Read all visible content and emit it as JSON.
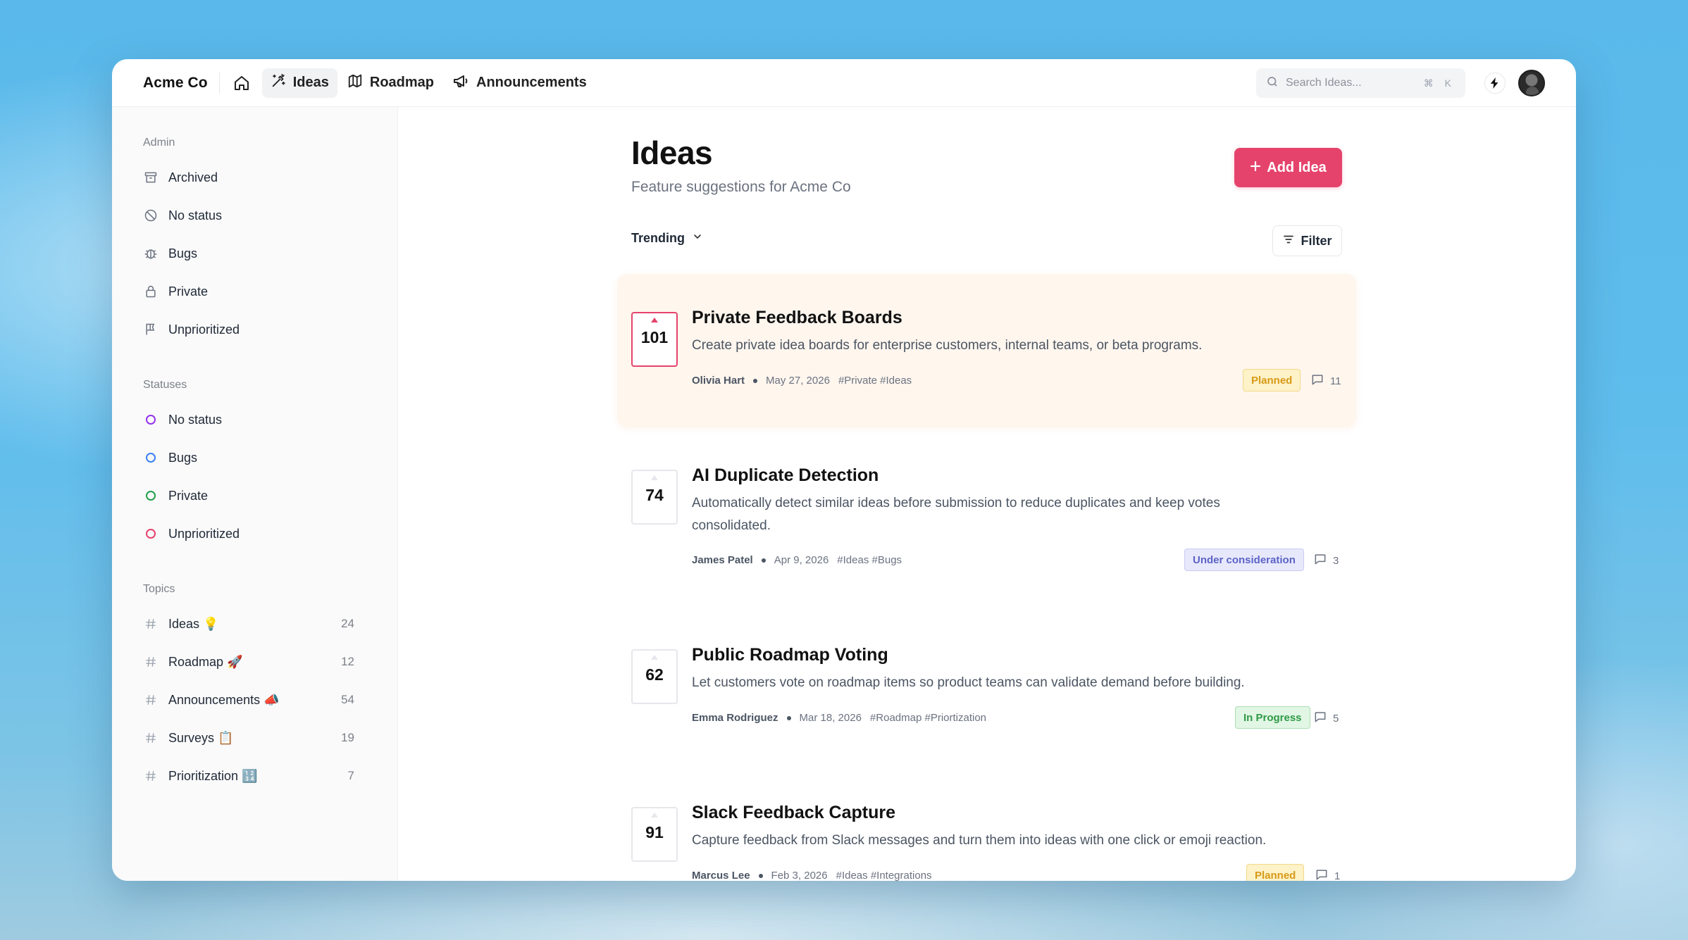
{
  "app": {
    "brand": "Acme Co",
    "nav": [
      {
        "label": "Ideas",
        "icon": "magic-wand-icon",
        "active": true
      },
      {
        "label": "Roadmap",
        "icon": "map-icon",
        "active": false
      },
      {
        "label": "Announcements",
        "icon": "megaphone-icon",
        "active": false
      }
    ],
    "search": {
      "placeholder": "Search Ideas...",
      "shortcut": "⌘ K"
    }
  },
  "sidebar": {
    "admin": {
      "title": "Admin",
      "items": [
        {
          "label": "Archived",
          "icon": "archive-icon"
        },
        {
          "label": "No status",
          "icon": "no-status-icon"
        },
        {
          "label": "Bugs",
          "icon": "bug-icon"
        },
        {
          "label": "Private",
          "icon": "lock-icon"
        },
        {
          "label": "Unprioritized",
          "icon": "flag-icon"
        }
      ]
    },
    "statuses": {
      "title": "Statuses",
      "items": [
        {
          "label": "No status",
          "color": "#9333ea"
        },
        {
          "label": "Bugs",
          "color": "#3b82f6"
        },
        {
          "label": "Private",
          "color": "#22a04b"
        },
        {
          "label": "Unprioritized",
          "color": "#e5436c"
        }
      ]
    },
    "topics": {
      "title": "Topics",
      "items": [
        {
          "label": "Ideas 💡",
          "count": "24"
        },
        {
          "label": "Roadmap 🚀",
          "count": "12"
        },
        {
          "label": "Announcements 📣",
          "count": "54"
        },
        {
          "label": "Surveys 📋",
          "count": "19"
        },
        {
          "label": "Prioritization 🔢",
          "count": "7"
        }
      ]
    }
  },
  "main": {
    "title": "Ideas",
    "subtitle": "Feature suggestions for Acme Co",
    "add_label": "Add Idea",
    "sort_label": "Trending",
    "filter_label": "Filter",
    "ideas": [
      {
        "votes": "101",
        "title": "Private Feedback Boards",
        "desc": "Create private idea boards for enterprise customers, internal teams, or beta programs.",
        "author": "Olivia Hart",
        "date": "May 27, 2026",
        "tags": "#Private  #Ideas",
        "status": "Planned",
        "comments": "11"
      },
      {
        "votes": "74",
        "title": "AI Duplicate Detection",
        "desc": "Automatically detect similar ideas before submission to reduce duplicates and keep votes consolidated.",
        "author": "James Patel",
        "date": "Apr 9, 2026",
        "tags": "#Ideas  #Bugs",
        "status": "Under consideration",
        "comments": "3"
      },
      {
        "votes": "62",
        "title": "Public Roadmap Voting",
        "desc": "Let customers vote on roadmap items so product teams can validate demand before building.",
        "author": "Emma Rodriguez",
        "date": "Mar 18, 2026",
        "tags": "#Roadmap  #Priortization",
        "status": "In Progress",
        "comments": "5"
      },
      {
        "votes": "91",
        "title": "Slack Feedback Capture",
        "desc": "Capture feedback from Slack messages and turn them into ideas with one click or emoji reaction.",
        "author": "Marcus Lee",
        "date": "Feb 3, 2026",
        "tags": "#Ideas  #Integrations",
        "status": "Planned",
        "comments": "1"
      }
    ]
  }
}
